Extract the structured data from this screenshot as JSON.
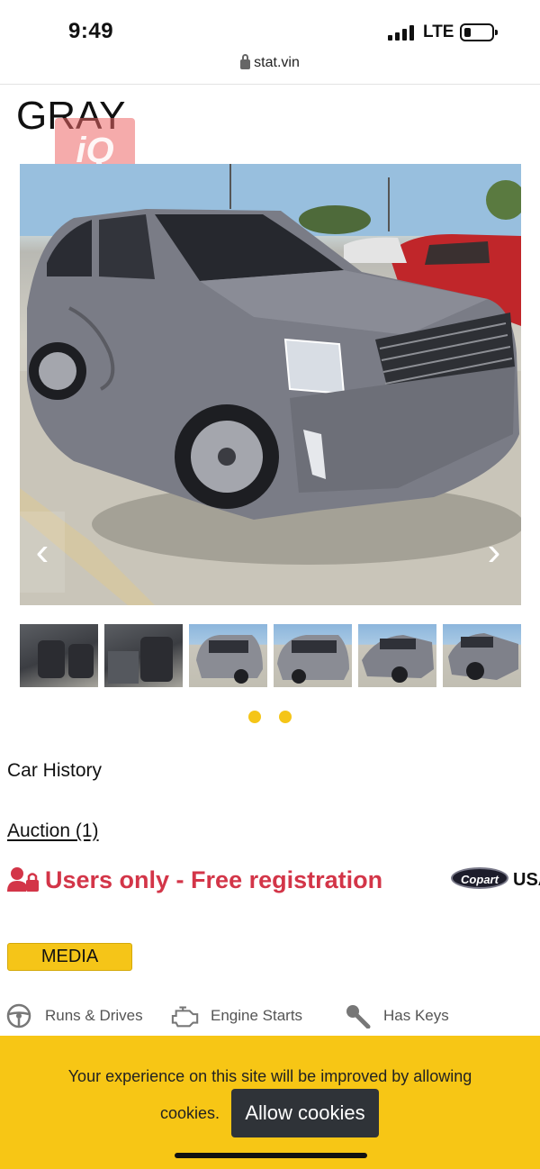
{
  "status_bar": {
    "time": "9:49",
    "network": "LTE"
  },
  "browser": {
    "url": "stat.vin"
  },
  "vehicle": {
    "color": "GRAY",
    "logo_text": "iQ"
  },
  "gallery": {
    "accent_color": "#f5c518",
    "thumbnails": [
      "interior-rear",
      "interior-front",
      "rear",
      "rear-quarter",
      "front-quarter",
      "front"
    ]
  },
  "sections": {
    "car_history": "Car History",
    "auction": "Auction (1)",
    "users_only": "Users only - Free registration",
    "copart": "Copart",
    "country": "USA",
    "media": "MEDIA"
  },
  "features": {
    "runs_drives": "Runs & Drives",
    "engine_starts": "Engine Starts",
    "has_keys": "Has Keys"
  },
  "cookie": {
    "message_line1": "Your experience on this site will be improved by allowing",
    "message_line2": "cookies.",
    "allow_label": "Allow cookies",
    "banner_color": "#f7c615"
  },
  "colors": {
    "alert_red": "#d33548"
  }
}
